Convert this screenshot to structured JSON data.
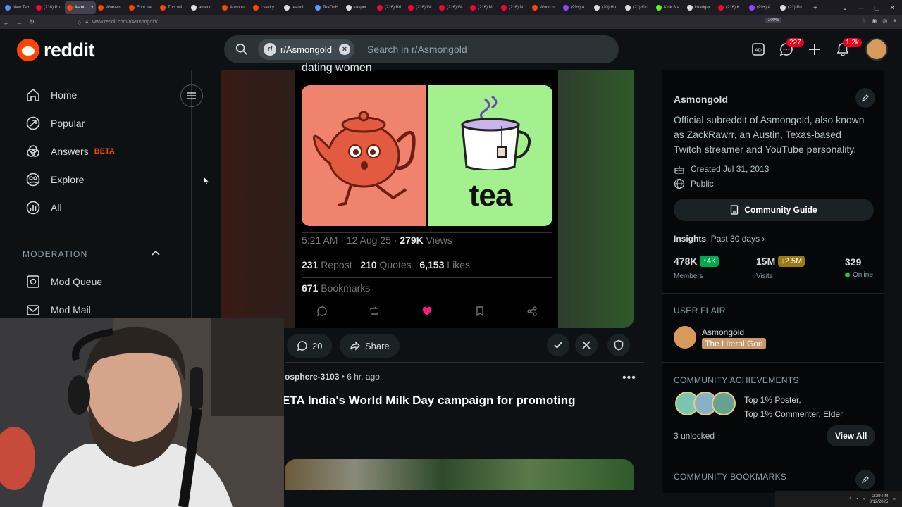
{
  "browser": {
    "tabs": [
      {
        "label": "New Tab",
        "color": "#5b8cff",
        "active": false
      },
      {
        "label": "(216) Pu",
        "color": "#ff0033",
        "active": false
      },
      {
        "label": "Asmo",
        "color": "#ff4500",
        "active": true
      },
      {
        "label": "Women",
        "color": "#ff4500",
        "active": false
      },
      {
        "label": "Foot tra",
        "color": "#ff4500",
        "active": false
      },
      {
        "label": "This wil",
        "color": "#ff4500",
        "active": false
      },
      {
        "label": "americ",
        "color": "#dddddd",
        "active": false
      },
      {
        "label": "Announ",
        "color": "#ff4500",
        "active": false
      },
      {
        "label": "I said y",
        "color": "#ff4500",
        "active": false
      },
      {
        "label": "teaonh",
        "color": "#dddddd",
        "active": false
      },
      {
        "label": "TeaOnH",
        "color": "#4aa3ff",
        "active": false
      },
      {
        "label": "kasper",
        "color": "#dddddd",
        "active": false
      },
      {
        "label": "(216) Bri",
        "color": "#ff0033",
        "active": false
      },
      {
        "label": "(216) W",
        "color": "#ff0033",
        "active": false
      },
      {
        "label": "(216) W",
        "color": "#ff0033",
        "active": false
      },
      {
        "label": "(216) M",
        "color": "#ff0033",
        "active": false
      },
      {
        "label": "(216) N",
        "color": "#ff0033",
        "active": false
      },
      {
        "label": "World o",
        "color": "#ff4500",
        "active": false
      },
      {
        "label": "(99+) A",
        "color": "#9146ff",
        "active": false
      },
      {
        "label": "(20) Ho",
        "color": "#dddddd",
        "active": false
      },
      {
        "label": "(21) Kic",
        "color": "#dddddd",
        "active": false
      },
      {
        "label": "Kick Sta",
        "color": "#53fc18",
        "active": false
      },
      {
        "label": "khadgar",
        "color": "#dddddd",
        "active": false
      },
      {
        "label": "(216) K",
        "color": "#ff0033",
        "active": false
      },
      {
        "label": "(99+) A",
        "color": "#9146ff",
        "active": false
      },
      {
        "label": "(21) Po",
        "color": "#dddddd",
        "active": false
      }
    ],
    "url": "www.reddit.com/r/Asmongold/",
    "zoom": "200%"
  },
  "header": {
    "wordmark": "reddit",
    "search_chip": "r/Asmongold",
    "search_placeholder": "Search in r/Asmongold",
    "chat_badge": "227",
    "notif_badge": "1.2k"
  },
  "sidebar": {
    "items": [
      {
        "label": "Home",
        "icon": "home-icon"
      },
      {
        "label": "Popular",
        "icon": "popular-icon"
      },
      {
        "label": "Answers",
        "icon": "answers-icon",
        "tag": "BETA"
      },
      {
        "label": "Explore",
        "icon": "explore-icon"
      },
      {
        "label": "All",
        "icon": "all-icon"
      }
    ],
    "moderation_header": "MODERATION",
    "mod_items": [
      {
        "label": "Mod Queue",
        "icon": "mod-queue-icon"
      },
      {
        "label": "Mod Mail",
        "icon": "mod-mail-icon"
      }
    ]
  },
  "post": {
    "tweet_text": "dating women",
    "image_caption": "tea",
    "meta_time": "5:21 AM · 12 Aug 25 · ",
    "views_num": "279K",
    "views_label": " Views",
    "reposts_num": "231",
    "reposts_label": " Repost",
    "quotes_num": "210",
    "quotes_label": " Quotes",
    "likes_num": "6,153",
    "likes_label": " Likes",
    "bookmarks_num": "671",
    "bookmarks_label": " Bookmarks",
    "comments_count": "20",
    "share_label": "Share"
  },
  "next_post": {
    "author": "osphere-3103",
    "time": " • 6 hr. ago",
    "title": "ETA India's World Milk Day campaign for promoting"
  },
  "right_sidebar": {
    "title": "Asmongold",
    "description": "Official subreddit of Asmongold, also known as ZackRawrr, an Austin, Texas-based Twitch streamer and YouTube personality.",
    "created": "Created Jul 31, 2013",
    "visibility": "Public",
    "guide_button": "Community Guide",
    "insights_label": "Insights",
    "insights_period": "Past 30 days ›",
    "members_value": "478K",
    "members_delta": "↑4K",
    "members_label": "Members",
    "visits_value": "15M",
    "visits_delta": "↓2.5M",
    "visits_label": "Visits",
    "online_value": "329",
    "online_label": "Online",
    "user_flair_header": "USER FLAIR",
    "flair_user": "Asmongold",
    "flair_tag": "The Literal God",
    "achievements_header": "COMMUNITY ACHIEVEMENTS",
    "achievements_line1": "Top 1% Poster,",
    "achievements_line2": "Top 1% Commenter, Elder",
    "unlocked": "3 unlocked",
    "view_all": "View All",
    "bookmarks_header": "COMMUNITY BOOKMARKS"
  },
  "taskbar": {
    "time": "2:29 PM",
    "date": "8/12/2025"
  },
  "colors": {
    "accent": "#ff4500",
    "like_pink": "#f91880",
    "members_delta_bg": "#02a84e",
    "visits_delta_bg": "#9a7a10",
    "online_dot": "#00d26a"
  }
}
